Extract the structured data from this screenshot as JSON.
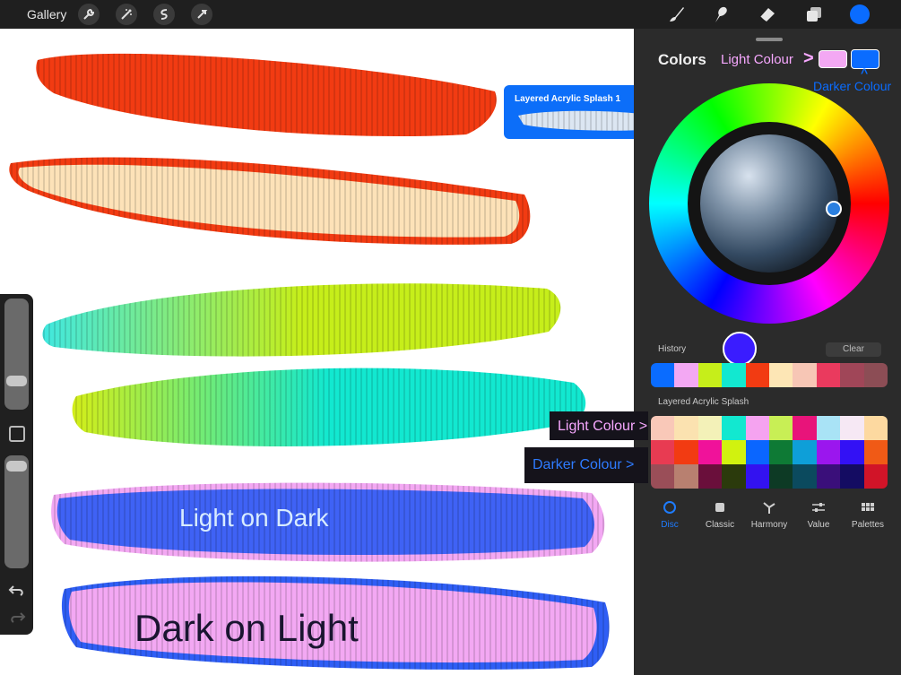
{
  "topbar": {
    "gallery_label": "Gallery",
    "left_tools": [
      "wrench-icon",
      "magic-wand-icon",
      "selection-s-icon",
      "transform-arrow-icon"
    ],
    "right_tools": [
      "brush-icon",
      "smudge-icon",
      "eraser-icon",
      "layers-icon"
    ],
    "active_color": "#0a6cff"
  },
  "canvas": {
    "label_light_on_dark": "Light on Dark",
    "label_dark_on_light": "Dark on Light"
  },
  "brush_popup": {
    "name": "Layered Acrylic Splash 1"
  },
  "colors_panel": {
    "title": "Colors",
    "light_colour_label": "Light Colour",
    "light_arrow": ">",
    "darker_colour_label": "Darker Colour",
    "darker_arrow": "^",
    "light_swatch": "#f3a8f3",
    "dark_swatch": "#0a6cff",
    "history_label": "History",
    "clear_label": "Clear",
    "history": [
      "#0a6cff",
      "#f3a8f3",
      "#c6ee1a",
      "#12e8d0",
      "#f23b12",
      "#fde6b5",
      "#f7c6b5",
      "#ea3a5e",
      "#a04658",
      "#8c4d55"
    ],
    "palette_label": "Layered Acrylic Splash",
    "palette": [
      "#f9c8b8",
      "#fbe2b0",
      "#f3f1b8",
      "#12e8d0",
      "#f5a3f0",
      "#c8ef55",
      "#e8147a",
      "#a9e3f6",
      "#f6e8f4",
      "#fdd9a0",
      "#e83b52",
      "#f23b12",
      "#f0129a",
      "#d1f20f",
      "#0a66ff",
      "#0e7a35",
      "#0e9fd8",
      "#9b16ee",
      "#3311f5",
      "#f05a16",
      "#9a4e58",
      "#b88070",
      "#6a0f3b",
      "#2b3a0c",
      "#3312f0",
      "#0d3a25",
      "#0b4a5e",
      "#3a0f7a",
      "#140c62",
      "#d11428"
    ],
    "tabs": [
      {
        "label": "Disc",
        "icon": "disc-icon"
      },
      {
        "label": "Classic",
        "icon": "classic-square-icon"
      },
      {
        "label": "Harmony",
        "icon": "harmony-icon"
      },
      {
        "label": "Value",
        "icon": "value-sliders-icon"
      },
      {
        "label": "Palettes",
        "icon": "palettes-grid-icon"
      }
    ]
  },
  "callouts": {
    "light": "Light Colour >",
    "dark": "Darker Colour >"
  }
}
